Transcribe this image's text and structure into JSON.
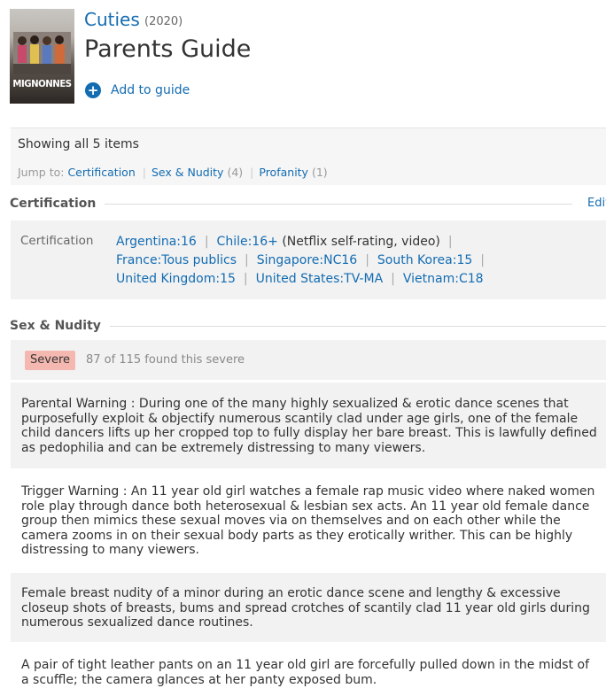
{
  "header": {
    "title": "Cuties",
    "year": "(2020)",
    "page_title": "Parents Guide",
    "add_label": "Add to guide",
    "poster_text": "MIGNONNES"
  },
  "summary": {
    "showing": "Showing all 5 items",
    "jump_label": "Jump to:",
    "jump_links": [
      {
        "label": "Certification",
        "count": ""
      },
      {
        "label": "Sex & Nudity",
        "count": "(4)"
      },
      {
        "label": "Profanity",
        "count": "(1)"
      }
    ]
  },
  "certification": {
    "heading": "Certification",
    "edit_label": "Edit",
    "row_label": "Certification",
    "lines": [
      [
        {
          "label": "Argentina:16",
          "note": ""
        },
        {
          "label": "Chile:16+",
          "note": "(Netflix self-rating, video)"
        }
      ],
      [
        {
          "label": "France:Tous publics",
          "note": ""
        },
        {
          "label": "Singapore:NC16",
          "note": ""
        },
        {
          "label": "South Korea:15",
          "note": ""
        }
      ],
      [
        {
          "label": "United Kingdom:15",
          "note": ""
        },
        {
          "label": "United States:TV-MA",
          "note": ""
        },
        {
          "label": "Vietnam:C18",
          "note": ""
        }
      ]
    ]
  },
  "sex_nudity": {
    "heading": "Sex & Nudity",
    "severity": "Severe",
    "votes": "87 of 115 found this severe",
    "items": [
      "Parental Warning : During one of the many highly sexualized & erotic dance scenes that\npurposefully exploit & objectify numerous scantily clad under age girls, one of the female\nchild dancers lifts up her cropped top to fully display her bare breast. This is lawfully defined\nas pedophilia and can be extremely distressing to many viewers.",
      "Trigger Warning : An 11 year old girl watches a female rap music video where naked women\nrole play through dance both heterosexual & lesbian sex acts. An 11 year old female dance\ngroup then mimics these sexual moves via on themselves and on each other while the\ncamera zooms in on their sexual body parts as they erotically writher. This can be highly\ndistressing to many viewers.",
      "Female breast nudity of a minor during an erotic dance scene and lengthy & excessive\ncloseup shots of breasts, bums and spread crotches of scantily clad 11 year old girls during\nnumerous sexualized dance routines.",
      "A pair of tight leather pants on an 11 year old girl are forcefully pulled down in the midst of\na scuffle; the camera glances at her panty exposed bum."
    ]
  },
  "colors": {
    "link": "#136cb2",
    "severe_badge": "#f4b8b0",
    "panel": "#f2f2f2"
  }
}
